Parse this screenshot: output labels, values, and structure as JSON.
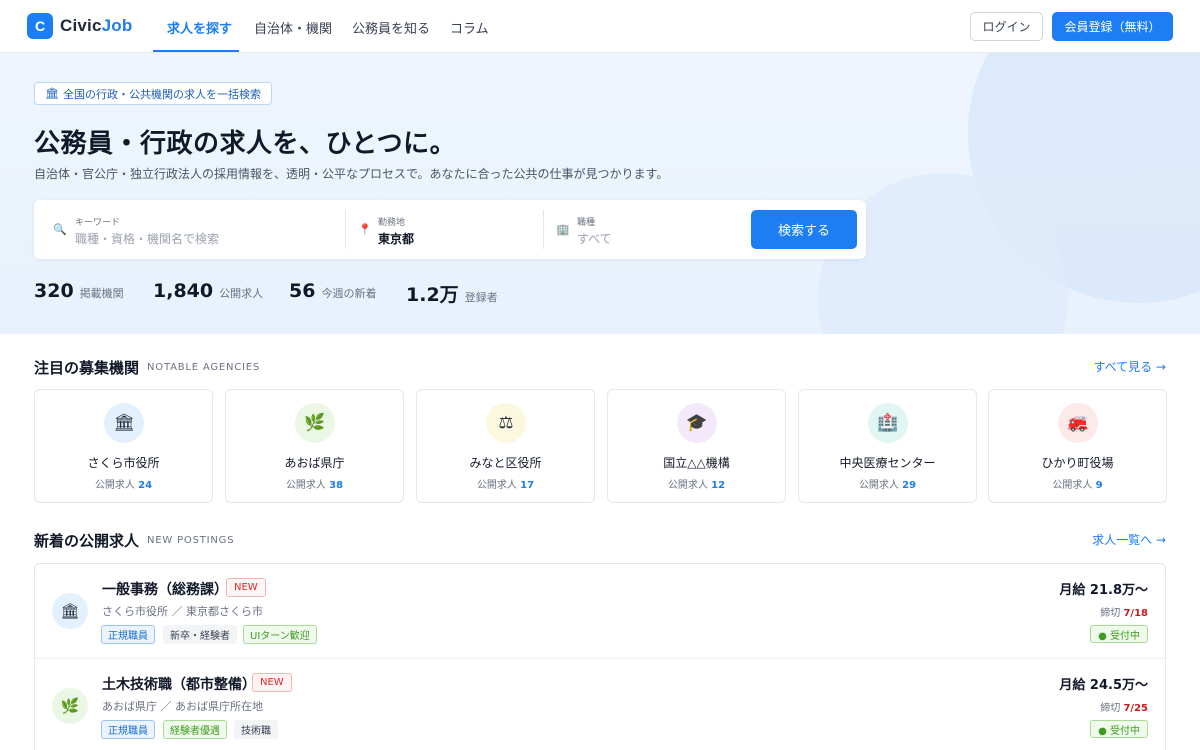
{
  "header": {
    "logo_mark": "C",
    "logo_name_1": "Civic",
    "logo_name_2": "Job",
    "nav": [
      "求人を探す",
      "自治体・機関",
      "公務員を知る",
      "コラム"
    ],
    "login_label": "ログイン",
    "register_label": "会員登録（無料）"
  },
  "hero": {
    "badge_icon": "🏛",
    "badge_text": "全国の行政・公共機関の求人を一括検索",
    "title": "公務員・行政の求人を、ひとつに。",
    "subtitle": "自治体・官公庁・独立行政法人の採用情報を、透明・公平なプロセスで。あなたに合った公共の仕事が見つかります。",
    "search": {
      "keyword_label": "キーワード",
      "keyword_placeholder": "職種・資格・機関名で検索",
      "location_label": "勤務地",
      "location_value": "東京都",
      "category_label": "職種",
      "category_value": "すべて",
      "button_label": "検索する"
    },
    "stats": [
      {
        "value": "320",
        "label": "掲載機関"
      },
      {
        "value": "1,840",
        "label": "公開求人"
      },
      {
        "value": "56",
        "label": "今週の新着"
      },
      {
        "value": "1.2万",
        "label": "登録者"
      }
    ]
  },
  "agencies_section": {
    "title": "注目の募集機関",
    "subtitle": "NOTABLE AGENCIES",
    "link": "すべて見る →",
    "count_prefix": "公開求人",
    "items": [
      {
        "name": "さくら市役所",
        "count": "24",
        "icon": "🏛",
        "bg": "#e3f0fd"
      },
      {
        "name": "あおば県庁",
        "count": "38",
        "icon": "🌿",
        "bg": "#eaf7e5"
      },
      {
        "name": "みなと区役所",
        "count": "17",
        "icon": "⚖",
        "bg": "#fbf8df"
      },
      {
        "name": "国立△△機構",
        "count": "12",
        "icon": "🎓",
        "bg": "#f3e9fb"
      },
      {
        "name": "中央医療センター",
        "count": "29",
        "icon": "🏥",
        "bg": "#e0f6f3"
      },
      {
        "name": "ひかり町役場",
        "count": "9",
        "icon": "🚒",
        "bg": "#fde9ea"
      }
    ]
  },
  "postings_section": {
    "title": "新着の公開求人",
    "subtitle": "NEW POSTINGS",
    "link": "求人一覧へ →",
    "jobs": [
      {
        "title": "一般事務（総務課）",
        "badge": "NEW",
        "org": "さくら市役所 ／ 東京都さくら市",
        "tags": [
          "正規職員",
          "新卒・経験者",
          "UIターン歓迎"
        ],
        "salary": "月給 21.8万〜",
        "deadline_label": "締切",
        "deadline": "7/18",
        "status": "● 受付中",
        "icon": "🏛",
        "bg": "#e3f0fd"
      },
      {
        "title": "土木技術職（都市整備）",
        "badge": "NEW",
        "org": "あおば県庁 ／ あおば県庁所在地",
        "tags": [
          "正規職員",
          "経験者優遇",
          "技術職"
        ],
        "salary": "月給 24.5万〜",
        "deadline_label": "締切",
        "deadline": "7/25",
        "status": "● 受付中",
        "icon": "🌿",
        "bg": "#eaf7e5"
      }
    ]
  }
}
